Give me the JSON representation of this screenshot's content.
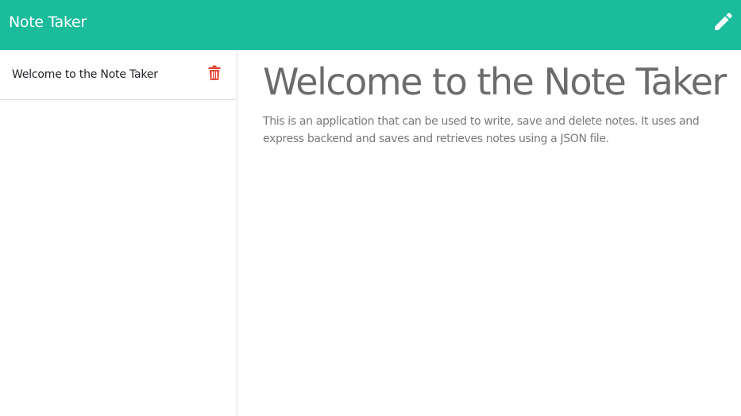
{
  "app": {
    "title": "Note Taker"
  },
  "navbar": {
    "new_note_icon": "pencil-icon"
  },
  "notes": [
    {
      "title": "Welcome to the Note Taker",
      "delete_icon": "trash-icon"
    }
  ],
  "active_note": {
    "title": "Welcome to the Note Taker",
    "text": "This is an application that can be used to write, save and delete notes. It uses and express backend and saves and retrieves notes using a JSON file."
  },
  "colors": {
    "navbar": "#1abc9c",
    "delete": "#e74c3c",
    "text": "#6c6c6c"
  }
}
